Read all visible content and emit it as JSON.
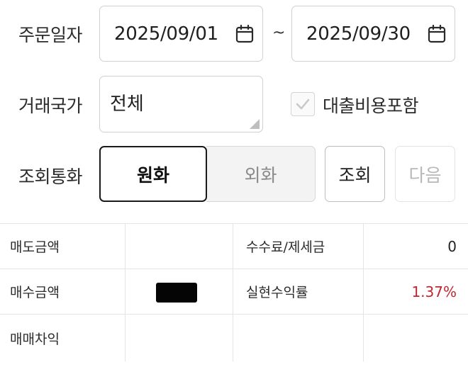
{
  "filter": {
    "order_date": {
      "label": "주문일자",
      "from": "2025/09/01",
      "to": "2025/09/30",
      "separator": "~"
    },
    "country": {
      "label": "거래국가",
      "value": "전체"
    },
    "include_loan_cost": {
      "label": "대출비용포함",
      "checked": true
    },
    "currency": {
      "label": "조회통화",
      "options": [
        "원화",
        "외화"
      ],
      "selected": "원화"
    },
    "search_button": "조회",
    "next_button": "다음"
  },
  "summary": {
    "sell_amount_label": "매도금액",
    "sell_amount_value": "",
    "fee_tax_label": "수수료/제세금",
    "fee_tax_value": "0",
    "buy_amount_label": "매수금액",
    "buy_amount_value": "",
    "realized_return_label": "실현수익률",
    "realized_return_value": "1.37%",
    "trading_profit_label": "매매차익",
    "trading_profit_value": ""
  },
  "colors": {
    "profit_red": "#c0262d",
    "border": "#d0d0d0",
    "selected_border": "#1a1a1a"
  },
  "icons": {
    "date_picker": "calendar-icon",
    "checkbox": "check-icon"
  }
}
